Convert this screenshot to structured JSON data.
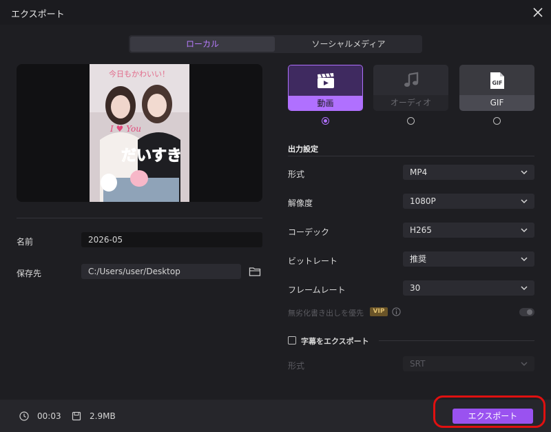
{
  "window": {
    "title": "エクスポート"
  },
  "tabs": [
    {
      "label": "ローカル",
      "active": true
    },
    {
      "label": "ソーシャルメディア",
      "active": false
    }
  ],
  "preview": {
    "thumbnail_texts": [
      "今日もかわいい！",
      "I ♥ You",
      "だいすき"
    ]
  },
  "left_panel": {
    "name_label": "名前",
    "name_value": "2026-05",
    "save_label": "保存先",
    "save_value": "C:/Users/user/Desktop"
  },
  "format_cards": [
    {
      "label": "動画",
      "icon": "clapperboard-icon",
      "selected": true
    },
    {
      "label": "オーディオ",
      "icon": "music-note-icon",
      "selected": false,
      "disabled": true
    },
    {
      "label": "GIF",
      "icon": "gif-file-icon",
      "icon_text": "GIF",
      "selected": false
    }
  ],
  "output_settings": {
    "section_title": "出力設定",
    "rows": [
      {
        "label": "形式",
        "value": "MP4"
      },
      {
        "label": "解像度",
        "value": "1080P"
      },
      {
        "label": "コーデック",
        "value": "H265"
      },
      {
        "label": "ビットレート",
        "value": "推奨"
      },
      {
        "label": "フレームレート",
        "value": "30"
      }
    ],
    "lossless_label": "無劣化書き出しを優先",
    "vip_badge": "VIP",
    "lossless_enabled": false
  },
  "subtitle": {
    "checkbox_label": "字幕をエクスポート",
    "checked": false,
    "format_label": "形式",
    "format_value": "SRT"
  },
  "footer": {
    "duration": "00:03",
    "size": "2.9MB",
    "export_label": "エクスポート"
  },
  "colors": {
    "accent": "#b070ff",
    "export_button": "#9a52f0",
    "annotation": "#e01010"
  }
}
